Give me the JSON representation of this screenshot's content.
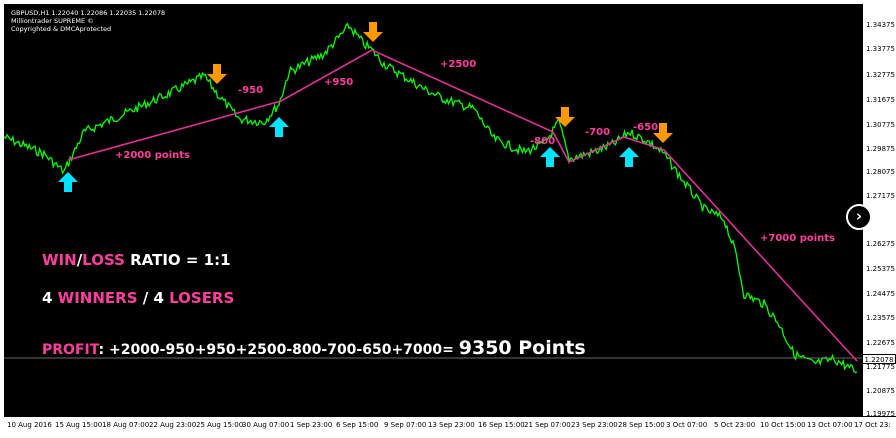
{
  "header": {
    "line1": "GBPUSD,H1  1.22040  1.22086  1.22035  1.22078",
    "line2": "Milliontrader SUPREME ©",
    "line3": "Copyrighted & DMCAprotected"
  },
  "price_axis": [
    "1.34375",
    "1.33775",
    "1.32775",
    "1.31675",
    "1.30775",
    "1.29875",
    "1.28075",
    "1.27175",
    "1.26275",
    "1.25375",
    "1.24475",
    "1.23575",
    "1.22675",
    "1.21775",
    "1.20875",
    "1.19975"
  ],
  "current_price": "1.22078",
  "date_axis": [
    "10 Aug 2016",
    "15 Aug 15:00",
    "18 Aug 07:00",
    "22 Aug 23:00",
    "25 Aug 15:00",
    "30 Aug 07:00",
    "1 Sep 23:00",
    "6 Sep 15:00",
    "9 Sep 07:00",
    "13 Sep 23:00",
    "16 Sep 15:00",
    "21 Sep 07:00",
    "23 Sep 23:00",
    "28 Sep 15:00",
    "3 Oct 07:00",
    "5 Oct 23:00",
    "10 Oct 15:00",
    "13 Oct 07:00",
    "17 Oct 23:"
  ],
  "trades": [
    {
      "label": "+2000 points"
    },
    {
      "label": "-950"
    },
    {
      "label": "+950"
    },
    {
      "label": "+2500"
    },
    {
      "label": "-800"
    },
    {
      "label": "-700"
    },
    {
      "label": "-650"
    },
    {
      "label": "+7000 points"
    }
  ],
  "summary": {
    "ratio_win": "WIN",
    "ratio_slash": "/",
    "ratio_loss": "LOSS",
    "ratio_rest": " RATIO = 1:1",
    "w_count": "4 ",
    "w_label": "WINNERS",
    "w_slash": " / 4 ",
    "l_label": "LOSERS",
    "profit_label": "PROFIT",
    "profit_expr": ": +2000-950+950+2500-800-700-650+7000= ",
    "profit_total": "9350 Points"
  },
  "colors": {
    "price": "#00ff00",
    "trade_line": "#e0309a",
    "buy_arrow": "#00e5ff",
    "sell_arrow": "#ff9900",
    "accent": "#ff3f9e"
  },
  "icons": [
    "buy-arrow-icon",
    "sell-arrow-icon",
    "chevron-right-icon"
  ]
}
